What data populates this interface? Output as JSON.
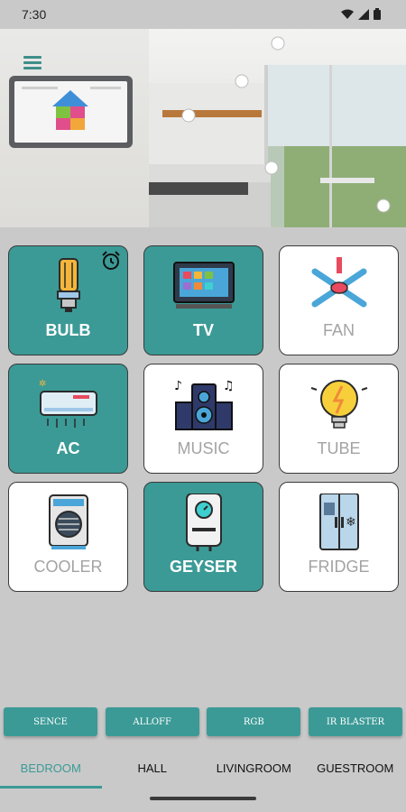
{
  "status_bar": {
    "time": "7:30",
    "icons": [
      "wifi-icon",
      "signal-icon",
      "battery-icon"
    ]
  },
  "hero": {
    "menu_icon": "menu-icon"
  },
  "devices": [
    {
      "label": "BULB",
      "state": "on",
      "icon": "bulb-icon",
      "alarm": true
    },
    {
      "label": "TV",
      "state": "on",
      "icon": "tv-icon"
    },
    {
      "label": "FAN",
      "state": "off",
      "icon": "fan-icon"
    },
    {
      "label": "AC",
      "state": "on",
      "icon": "ac-icon"
    },
    {
      "label": "MUSIC",
      "state": "off",
      "icon": "music-icon"
    },
    {
      "label": "TUBE",
      "state": "off",
      "icon": "tube-icon"
    },
    {
      "label": "COOLER",
      "state": "off",
      "icon": "cooler-icon"
    },
    {
      "label": "GEYSER",
      "state": "on",
      "icon": "geyser-icon"
    },
    {
      "label": "FRIDGE",
      "state": "off",
      "icon": "fridge-icon"
    }
  ],
  "actions": [
    "SENCE",
    "ALLOFF",
    "RGB",
    "IR BLASTER"
  ],
  "tabs": [
    {
      "label": "BEDROOM",
      "active": true
    },
    {
      "label": "HALL",
      "active": false
    },
    {
      "label": "LIVINGROOM",
      "active": false
    },
    {
      "label": "GUESTROOM",
      "active": false
    }
  ],
  "colors": {
    "accent": "#3b9a96",
    "tile_off": "#ffffff",
    "background": "#c9c9c9"
  }
}
